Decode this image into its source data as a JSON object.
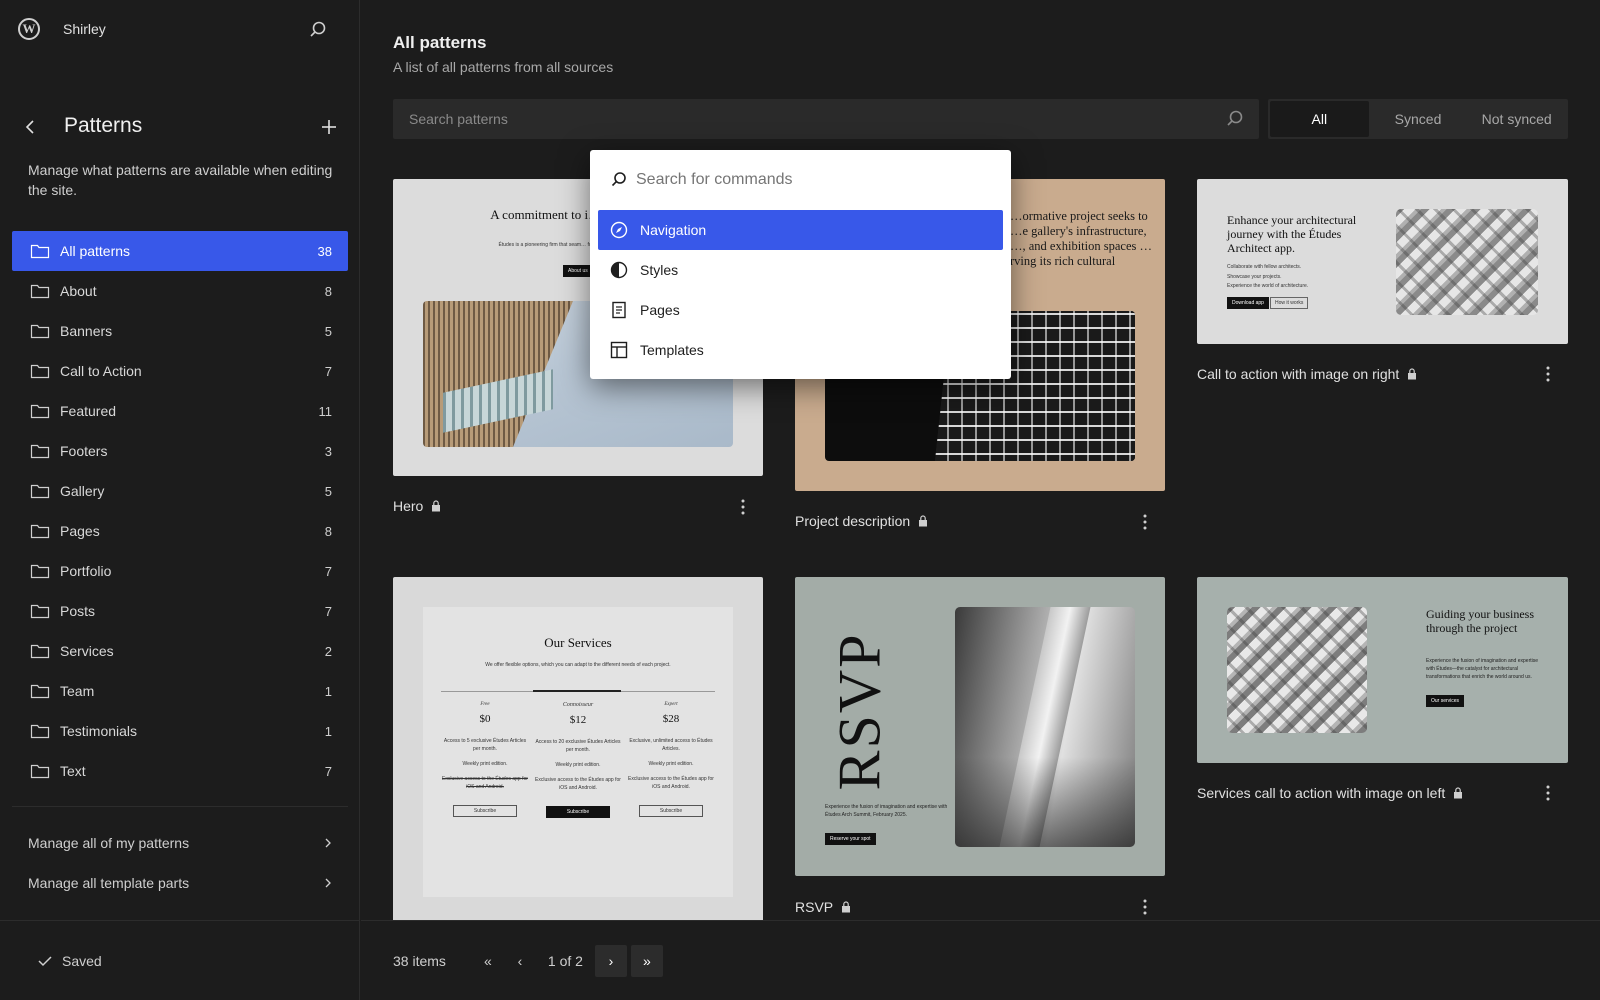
{
  "sidebar": {
    "site_name": "Shirley",
    "title": "Patterns",
    "description": "Manage what patterns are available when editing the site.",
    "categories": [
      {
        "label": "All patterns",
        "count": "38"
      },
      {
        "label": "About",
        "count": "8"
      },
      {
        "label": "Banners",
        "count": "5"
      },
      {
        "label": "Call to Action",
        "count": "7"
      },
      {
        "label": "Featured",
        "count": "11"
      },
      {
        "label": "Footers",
        "count": "3"
      },
      {
        "label": "Gallery",
        "count": "5"
      },
      {
        "label": "Pages",
        "count": "8"
      },
      {
        "label": "Portfolio",
        "count": "7"
      },
      {
        "label": "Posts",
        "count": "7"
      },
      {
        "label": "Services",
        "count": "2"
      },
      {
        "label": "Team",
        "count": "1"
      },
      {
        "label": "Testimonials",
        "count": "1"
      },
      {
        "label": "Text",
        "count": "7"
      }
    ],
    "links": [
      "Manage all of my patterns",
      "Manage all template parts"
    ],
    "saved_label": "Saved"
  },
  "main": {
    "title": "All patterns",
    "subtitle": "A list of all patterns from all sources",
    "search_placeholder": "Search patterns",
    "filters": [
      "All",
      "Synced",
      "Not synced"
    ],
    "cards": [
      {
        "title": "Hero"
      },
      {
        "title": "Project description"
      },
      {
        "title": "Call to action with image on right"
      },
      {
        "title": ""
      },
      {
        "title": "RSVP"
      },
      {
        "title": "Services call to action with image on left"
      }
    ],
    "pager": {
      "items": "38 items",
      "first": "«",
      "prev": "‹",
      "page": "1 of 2",
      "next": "›",
      "last": "»"
    }
  },
  "thumbs": {
    "hero": {
      "heading": "A commitment to i… sustainab…",
      "body": "Études is a pioneering firm that seam… functionality to redefine archit…",
      "button": "About us"
    },
    "project": {
      "heading": "…ormative project seeks to …e gallery's infrastructure, …, and exhibition spaces …rving its rich cultural"
    },
    "cta": {
      "heading": "Enhance your architectural journey with the Études Architect app.",
      "bullets": [
        "Collaborate with fellow architects.",
        "Showcase your projects.",
        "Experience the world of architecture."
      ],
      "btn1": "Download app",
      "btn2": "How it works"
    },
    "services": {
      "heading": "Our Services",
      "sub": "We offer flexible options, which you can adapt to the different needs of each project.",
      "tiers": [
        {
          "name": "Free",
          "price": "$0",
          "f1": "Access to 5 exclusive Études Articles per month.",
          "f2": "Weekly print edition.",
          "f3": "Exclusive access to the Études app for iOS and Android.",
          "btn": "Subscribe"
        },
        {
          "name": "Connoisseur",
          "price": "$12",
          "f1": "Access to 20 exclusive Études Articles per month.",
          "f2": "Weekly print edition.",
          "f3": "Exclusive access to the Études app for iOS and Android.",
          "btn": "Subscribe"
        },
        {
          "name": "Expert",
          "price": "$28",
          "f1": "Exclusive, unlimited access to Études Articles.",
          "f2": "Weekly print edition.",
          "f3": "Exclusive access to the Études app for iOS and Android.",
          "btn": "Subscribe"
        }
      ]
    },
    "rsvp": {
      "big": "RSVP",
      "body": "Experience the fusion of imagination and expertise with Études Arch Summit, February 2025.",
      "button": "Reserve your spot"
    },
    "svc_cta": {
      "heading": "Guiding your business through the project",
      "body": "Experience the fusion of imagination and expertise with Études—the catalyst for architectural transformations that enrich the world around us.",
      "button": "Our services"
    }
  },
  "palette": {
    "placeholder": "Search for commands",
    "items": [
      {
        "label": "Navigation",
        "icon": "compass-icon"
      },
      {
        "label": "Styles",
        "icon": "half-circle-icon"
      },
      {
        "label": "Pages",
        "icon": "page-icon"
      },
      {
        "label": "Templates",
        "icon": "layout-icon"
      }
    ]
  },
  "colors": {
    "accent": "#3858e9",
    "background": "#1c1c1c"
  }
}
